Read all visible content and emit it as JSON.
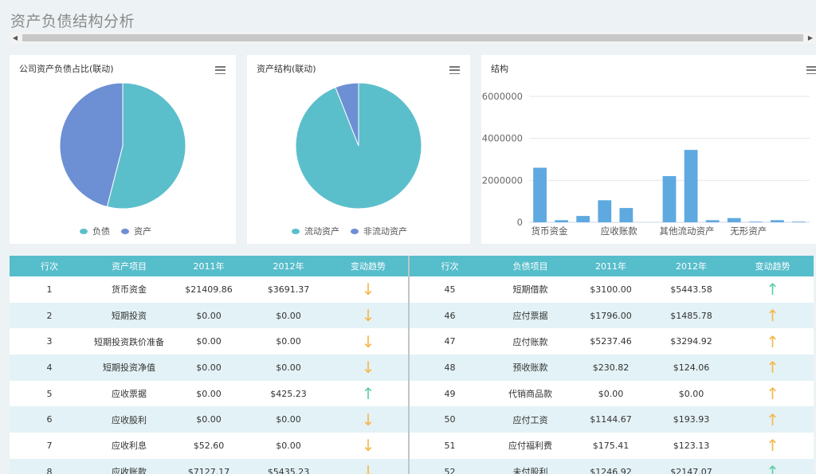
{
  "page": {
    "title": "资产负债结构分析"
  },
  "scrollbar": {
    "left_arrow": "◀",
    "right_arrow": "▶"
  },
  "panels": {
    "pie1": {
      "title": "公司资产负债占比(联动)",
      "slices": [
        {
          "name": "负债",
          "value": 54,
          "color": "#5bbfcb"
        },
        {
          "name": "资产",
          "value": 46,
          "color": "#6d8fd3"
        }
      ]
    },
    "pie2": {
      "title": "资产结构(联动)",
      "slices": [
        {
          "name": "流动资产",
          "value": 94,
          "color": "#5bbfcb"
        },
        {
          "name": "非流动资产",
          "value": 6,
          "color": "#6d8fd3"
        }
      ]
    },
    "bar": {
      "title": "结构"
    }
  },
  "chart_data": {
    "type": "bar",
    "title": "结构",
    "categories": [
      "货币资金",
      "",
      "",
      "应收账款",
      "",
      "",
      "其他流动资产",
      "",
      "",
      "无形资产",
      "",
      ""
    ],
    "tick_labels": [
      "货币资金",
      "应收账款",
      "其他流动资产",
      "无形资产"
    ],
    "values": [
      2600000,
      100000,
      300000,
      1050000,
      680000,
      0,
      2200000,
      3450000,
      100000,
      200000,
      30000,
      100000,
      30000
    ],
    "ylim": [
      0,
      6000000
    ],
    "yticks": [
      "0",
      "2000000",
      "4000000",
      "6000000"
    ],
    "color": "#5ea9e0",
    "grid": true
  },
  "table": {
    "headers_left": [
      "行次",
      "资产项目",
      "2011年",
      "2012年",
      "变动趋势"
    ],
    "headers_right": [
      "行次",
      "负债项目",
      "2011年",
      "2012年",
      "变动趋势"
    ],
    "rows_left": [
      {
        "no": "1",
        "item": "货币资金",
        "y2011": "$21409.86",
        "y2012": "$3691.37",
        "trend": "down"
      },
      {
        "no": "2",
        "item": "短期投资",
        "y2011": "$0.00",
        "y2012": "$0.00",
        "trend": "down"
      },
      {
        "no": "3",
        "item": "短期投资跌价准备",
        "y2011": "$0.00",
        "y2012": "$0.00",
        "trend": "down"
      },
      {
        "no": "4",
        "item": "短期投资净值",
        "y2011": "$0.00",
        "y2012": "$0.00",
        "trend": "down"
      },
      {
        "no": "5",
        "item": "应收票据",
        "y2011": "$0.00",
        "y2012": "$425.23",
        "trend": "up-teal"
      },
      {
        "no": "6",
        "item": "应收股利",
        "y2011": "$0.00",
        "y2012": "$0.00",
        "trend": "down"
      },
      {
        "no": "7",
        "item": "应收利息",
        "y2011": "$52.60",
        "y2012": "$0.00",
        "trend": "down"
      },
      {
        "no": "8",
        "item": "应收账款",
        "y2011": "$7127.17",
        "y2012": "$5435.23",
        "trend": "down"
      }
    ],
    "rows_right": [
      {
        "no": "45",
        "item": "短期借款",
        "y2011": "$3100.00",
        "y2012": "$5443.58",
        "trend": "up-teal"
      },
      {
        "no": "46",
        "item": "应付票据",
        "y2011": "$1796.00",
        "y2012": "$1485.78",
        "trend": "up-orange"
      },
      {
        "no": "47",
        "item": "应付账款",
        "y2011": "$5237.46",
        "y2012": "$3294.92",
        "trend": "up-orange"
      },
      {
        "no": "48",
        "item": "预收账款",
        "y2011": "$230.82",
        "y2012": "$124.06",
        "trend": "up-orange"
      },
      {
        "no": "49",
        "item": "代销商品款",
        "y2011": "$0.00",
        "y2012": "$0.00",
        "trend": "up-orange"
      },
      {
        "no": "50",
        "item": "应付工资",
        "y2011": "$1144.67",
        "y2012": "$193.93",
        "trend": "up-orange"
      },
      {
        "no": "51",
        "item": "应付福利费",
        "y2011": "$175.41",
        "y2012": "$123.13",
        "trend": "up-orange"
      },
      {
        "no": "52",
        "item": "未付股利",
        "y2011": "$1246.92",
        "y2012": "$2147.07",
        "trend": "up-teal"
      }
    ]
  }
}
